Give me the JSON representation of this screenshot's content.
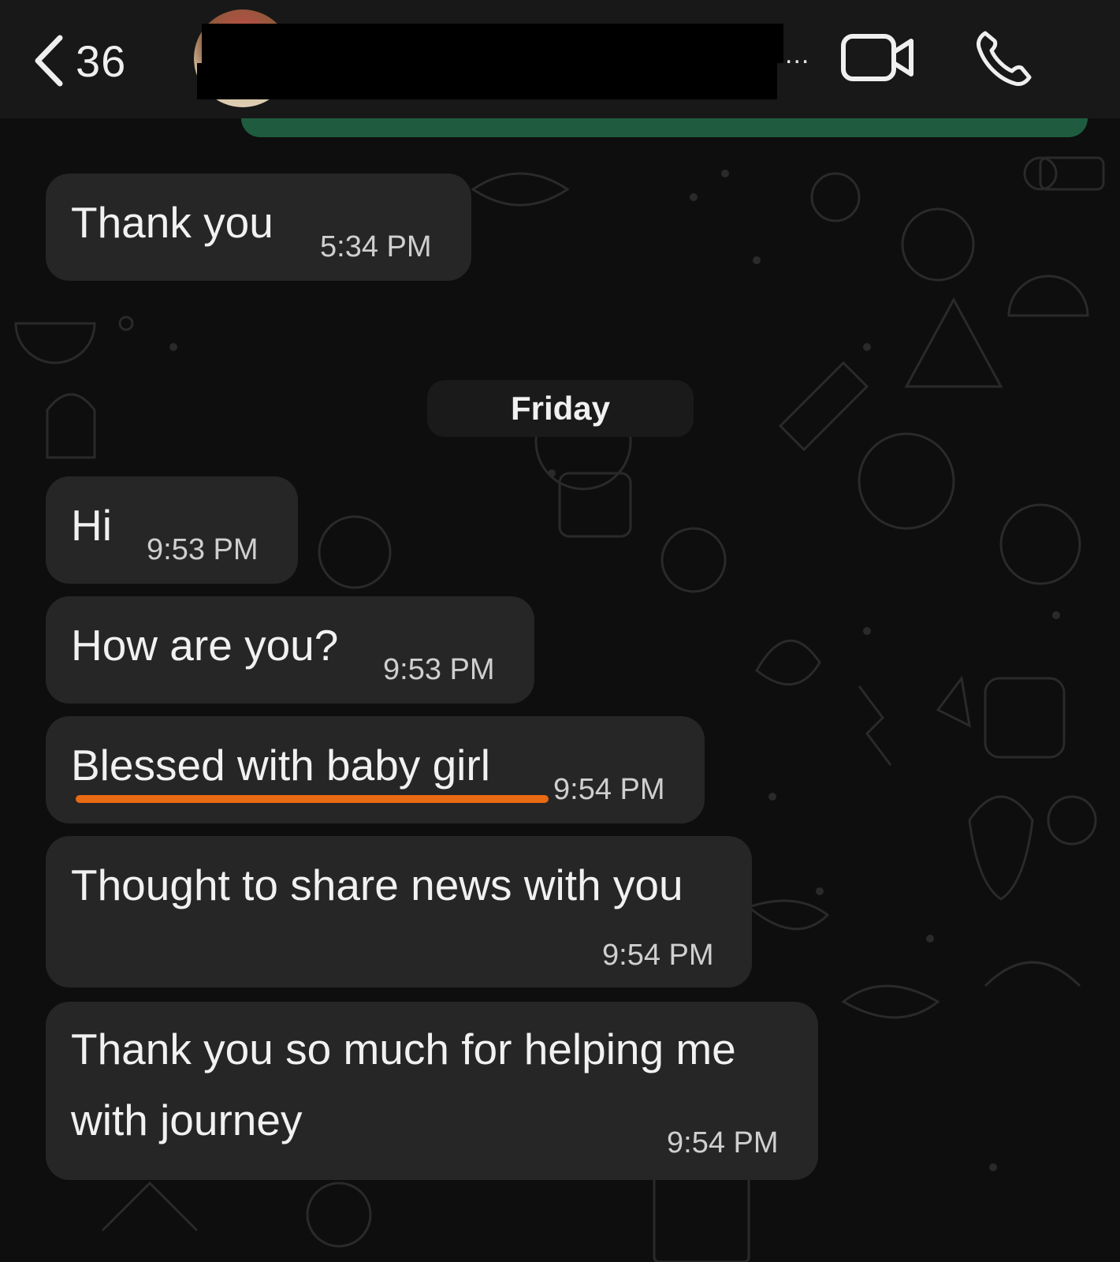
{
  "header": {
    "back_count": "36",
    "more_label": "...",
    "icons": {
      "back": "chevron-left-icon",
      "video": "video-camera-icon",
      "call": "phone-icon"
    }
  },
  "date_separator": "Friday",
  "messages": [
    {
      "text": "Thank you",
      "time": "5:34 PM"
    },
    {
      "text": "Hi",
      "time": "9:53 PM"
    },
    {
      "text": "How are you?",
      "time": "9:53 PM"
    },
    {
      "text": "Blessed with baby girl",
      "time": "9:54 PM",
      "highlighted": true
    },
    {
      "text": "Thought to share news with you",
      "time": "9:54 PM"
    },
    {
      "text_line1": "Thank you so much for helping me",
      "text_line2": "with journey",
      "time": "9:54 PM"
    }
  ],
  "colors": {
    "background": "#0e0e0e",
    "header": "#181818",
    "bubble": "#262626",
    "sent_bubble": "#1f5b3f",
    "highlight": "#e86a12"
  }
}
